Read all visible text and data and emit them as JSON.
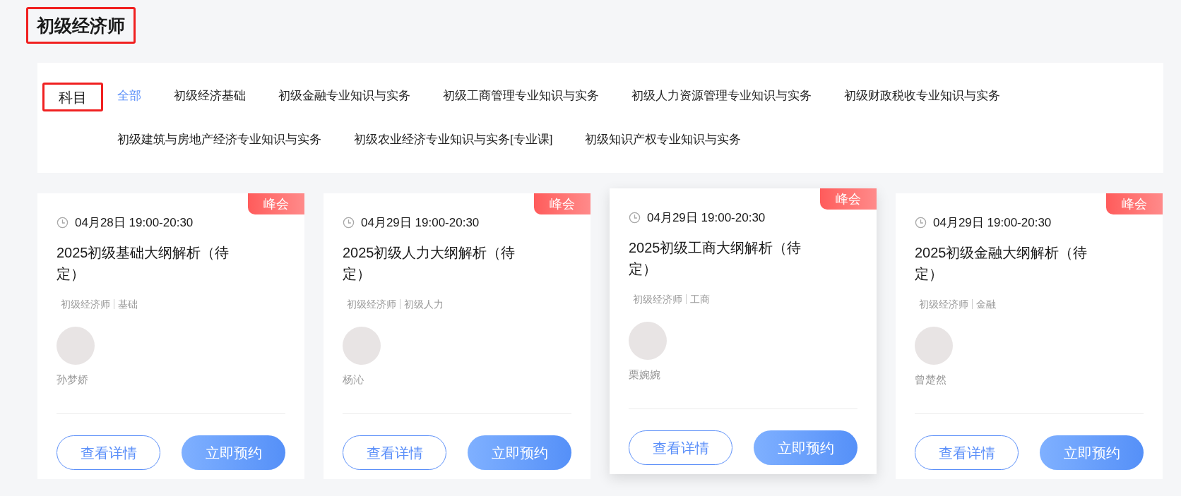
{
  "page_title": "初级经济师",
  "filter": {
    "label": "科目",
    "options": [
      {
        "label": "全部",
        "selected": true
      },
      {
        "label": "初级经济基础",
        "selected": false
      },
      {
        "label": "初级金融专业知识与实务",
        "selected": false
      },
      {
        "label": "初级工商管理专业知识与实务",
        "selected": false
      },
      {
        "label": "初级人力资源管理专业知识与实务",
        "selected": false
      },
      {
        "label": "初级财政税收专业知识与实务",
        "selected": false
      },
      {
        "label": "初级建筑与房地产经济专业知识与实务",
        "selected": false
      },
      {
        "label": "初级农业经济专业知识与实务[专业课]",
        "selected": false
      },
      {
        "label": "初级知识产权专业知识与实务",
        "selected": false
      }
    ]
  },
  "courses": [
    {
      "badge": "峰会",
      "time": "04月28日 19:00-20:30",
      "title": "2025初级基础大纲解析（待定）",
      "tags": [
        "初级经济师",
        "基础"
      ],
      "teacher": "孙梦娇",
      "hovered": false,
      "buttons": [
        "查看详情",
        "立即预约"
      ]
    },
    {
      "badge": "峰会",
      "time": "04月29日 19:00-20:30",
      "title": "2025初级人力大纲解析（待定）",
      "tags": [
        "初级经济师",
        "初级人力"
      ],
      "teacher": "杨沁",
      "hovered": false,
      "buttons": [
        "查看详情",
        "立即预约"
      ]
    },
    {
      "badge": "峰会",
      "time": "04月29日 19:00-20:30",
      "title": "2025初级工商大纲解析（待定）",
      "tags": [
        "初级经济师",
        "工商"
      ],
      "teacher": "栗婉婉",
      "hovered": true,
      "buttons": [
        "查看详情",
        "立即预约"
      ]
    },
    {
      "badge": "峰会",
      "time": "04月29日 19:00-20:30",
      "title": "2025初级金融大纲解析（待定）",
      "tags": [
        "初级经济师",
        "金融"
      ],
      "teacher": "曾楚然",
      "hovered": false,
      "buttons": [
        "查看详情",
        "立即预约"
      ]
    }
  ]
}
